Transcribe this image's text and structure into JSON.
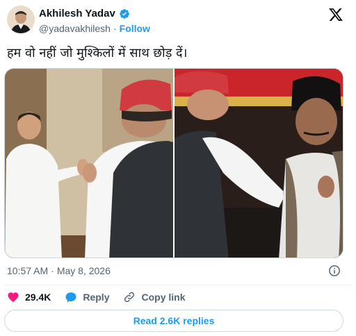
{
  "author": {
    "display_name": "Akhilesh Yadav",
    "handle": "@yadavakhilesh",
    "separator": "·",
    "follow_label": "Follow",
    "verified_color": "#1d9bf0"
  },
  "tweet": {
    "text": "हम वो नहीं जो मुश्किलों में साथ छोड़ दें।",
    "time": "10:57 AM",
    "separator": "·",
    "date": "May 8, 2026"
  },
  "actions": {
    "likes_count": "29.4K",
    "reply_label": "Reply",
    "copy_label": "Copy link"
  },
  "read_replies_label": "Read 2.6K replies",
  "colors": {
    "accent": "#1d9bf0",
    "like": "#f91880",
    "text_secondary": "#536471"
  },
  "icons": {
    "brand": "x-logo-icon",
    "verified": "verified-badge-icon",
    "like": "heart-icon",
    "reply": "comment-bubble-icon",
    "copy": "link-icon",
    "info": "info-icon"
  }
}
